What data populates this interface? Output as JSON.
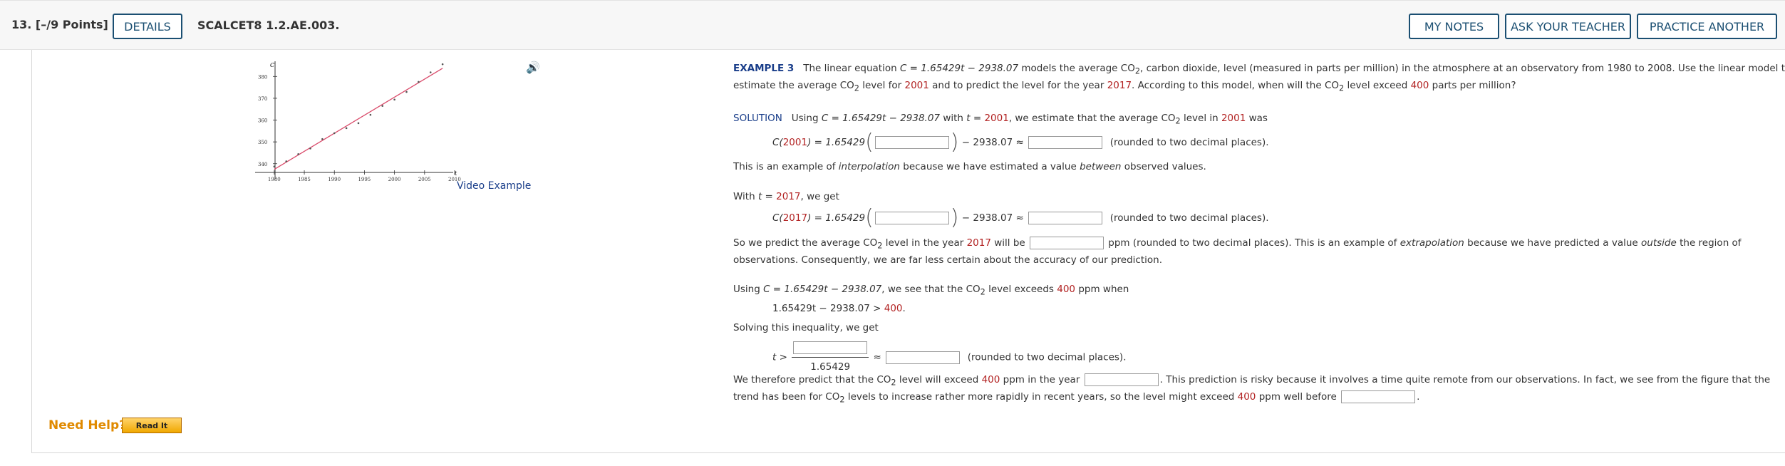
{
  "header": {
    "question_number": "13. [–/9 Points]",
    "details_label": "DETAILS",
    "code": "SCALCET8 1.2.AE.003.",
    "my_notes_label": "MY NOTES",
    "ask_teacher_label": "ASK YOUR TEACHER",
    "practice_label": "PRACTICE ANOTHER"
  },
  "figure": {
    "y_axis_label": "C",
    "x_axis_label": "t",
    "y_ticks": [
      "380",
      "370",
      "360",
      "350",
      "340"
    ],
    "x_ticks": [
      "1980",
      "1985",
      "1990",
      "1995",
      "2000",
      "2005",
      "2010"
    ],
    "video_label": "Video Example"
  },
  "chart_data": {
    "type": "scatter",
    "x_range": [
      1978,
      2010
    ],
    "y_range": [
      336,
      385
    ],
    "points": [
      [
        1980,
        338.7
      ],
      [
        1982,
        341.1
      ],
      [
        1984,
        344.4
      ],
      [
        1986,
        347.0
      ],
      [
        1988,
        351.3
      ],
      [
        1990,
        354.0
      ],
      [
        1992,
        356.3
      ],
      [
        1994,
        358.6
      ],
      [
        1996,
        362.4
      ],
      [
        1998,
        366.5
      ],
      [
        2000,
        369.4
      ],
      [
        2002,
        372.9
      ],
      [
        2004,
        377.5
      ],
      [
        2006,
        381.9
      ],
      [
        2008,
        385.6
      ]
    ],
    "line": {
      "slope": 1.65429,
      "intercept": -2938.07
    }
  },
  "help": {
    "need_help": "Need Help?",
    "read_it": "Read It"
  },
  "text": {
    "ex_label": "EXAMPLE 3",
    "ex_line1_a": "The linear equation  ",
    "eq1": "C = 1.65429t − 2938.07",
    "ex_line1_b": "  models the average CO",
    "ex_line1_c": ", carbon dioxide, level (measured in parts per million) in the atmosphere at an observatory from 1980 to 2008. Use the linear model to",
    "ex_line2_a": "estimate the average CO",
    "ex_line2_b": " level for ",
    "y2001": "2001",
    "ex_line2_c": " and to predict the level for the year ",
    "y2017": "2017",
    "ex_line2_d": ". According to this model, when will the CO",
    "ex_line2_e": " level exceed ",
    "v400": "400",
    "ex_line2_f": " parts per million?",
    "sol_label": "SOLUTION",
    "sol_a": "Using  ",
    "sol_eq": "C = 1.65429t − 2938.07",
    "sol_b": "  with  ",
    "sol_t": "t = ",
    "sol_c": ",  we estimate that the average CO",
    "sol_d": " level in ",
    "sol_e": " was",
    "c2001_a": "C(",
    "c2001_b": ") = 1.65429",
    "minus": "− 2938.07 ≈",
    "rounded": "(rounded to two decimal places).",
    "interp_a": "This is an example of ",
    "interp_em": "interpolation",
    "interp_b": " because we have estimated a value ",
    "interp_em2": "between",
    "interp_c": " observed values.",
    "with_a": "With  ",
    "with_b": ",  we get",
    "predict_a": "So we predict the average CO",
    "predict_b": " level in the year ",
    "predict_c": " will be ",
    "predict_d": " ppm (rounded to two decimal places). This is an example of ",
    "predict_em": "extrapolation",
    "predict_e": " because we have predicted a value ",
    "predict_em2": "outside",
    "predict_f": " the region of",
    "predict_line2": "observations. Consequently, we are far less certain about the accuracy of our prediction.",
    "using_a": "Using  ",
    "using_b": ",  we see that the CO",
    "using_c": " level exceeds ",
    "using_d": " ppm when",
    "ineq": "1.65429t − 2938.07 > ",
    "solving": "Solving this inequality, we get",
    "t_gt": "t >",
    "den": "1.65429",
    "approx": "≈",
    "therefore_a": "We therefore predict that the CO",
    "therefore_b": " level will exceed ",
    "therefore_c": " ppm in the year ",
    "therefore_d": ". This prediction is risky because it involves a time quite remote from our observations. In fact, we see from the figure that the",
    "trend_a": "trend has been for CO",
    "trend_b": " levels to increase rather more rapidly in recent years, so the level might exceed ",
    "trend_c": " ppm well before ",
    "trend_d": ".",
    "sub2": "2"
  }
}
